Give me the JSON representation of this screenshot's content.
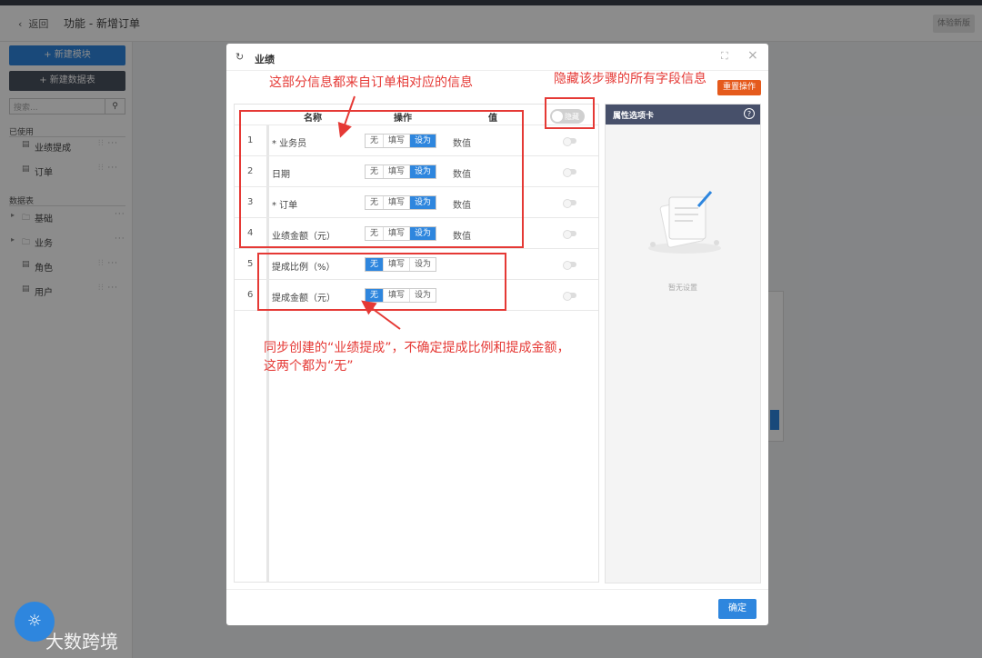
{
  "header": {
    "back_label": "返回",
    "title": "功能 - 新增订单",
    "trial_label": "体验新版"
  },
  "sidebar": {
    "new_module": "+ 新建模块",
    "new_table": "+ 新建数据表",
    "search_placeholder": "搜索...",
    "used_section": "已使用",
    "used_items": [
      {
        "label": "业绩提成"
      },
      {
        "label": "订单"
      }
    ],
    "tables_section": "数据表",
    "table_items": [
      {
        "label": "基础"
      },
      {
        "label": "业务"
      },
      {
        "label": "角色"
      },
      {
        "label": "用户"
      }
    ]
  },
  "modal": {
    "title": "业绩",
    "reset_button": "重置操作",
    "hide_toggle_label": "隐藏",
    "columns": {
      "name": "名称",
      "op": "操作",
      "value": "值"
    },
    "rows": [
      {
        "num": "1",
        "name": "* 业务员",
        "ops": [
          "无",
          "填写",
          "设为"
        ],
        "selected": 2,
        "value": "数值"
      },
      {
        "num": "2",
        "name": "日期",
        "ops": [
          "无",
          "填写",
          "设为"
        ],
        "selected": 2,
        "value": "数值"
      },
      {
        "num": "3",
        "name": "* 订单",
        "ops": [
          "无",
          "填写",
          "设为"
        ],
        "selected": 2,
        "value": "数值"
      },
      {
        "num": "4",
        "name": "业绩金额（元）",
        "ops": [
          "无",
          "填写",
          "设为"
        ],
        "selected": 2,
        "value": "数值"
      },
      {
        "num": "5",
        "name": "提成比例（%）",
        "ops": [
          "无",
          "填写",
          "设为"
        ],
        "selected": 0,
        "value": ""
      },
      {
        "num": "6",
        "name": "提成金额（元）",
        "ops": [
          "无",
          "填写",
          "设为"
        ],
        "selected": 0,
        "value": ""
      }
    ],
    "property_panel_title": "属性选项卡",
    "property_help": "?",
    "empty_text": "暂无设置",
    "ok_button": "确定"
  },
  "annotations": {
    "top_note": "这部分信息都来自订单相对应的信息",
    "hide_note": "隐藏该步骤的所有字段信息",
    "bottom_note_line1": "同步创建的“业绩提成”，不确定提成比例和提成金额，",
    "bottom_note_line2": "这两个都为“无”"
  },
  "watermark": {
    "text": "大数跨境"
  },
  "colors": {
    "primary": "#2e86de",
    "accent_red": "#e53935",
    "reset_orange": "#e55a1c",
    "panel_header": "#47506a"
  }
}
